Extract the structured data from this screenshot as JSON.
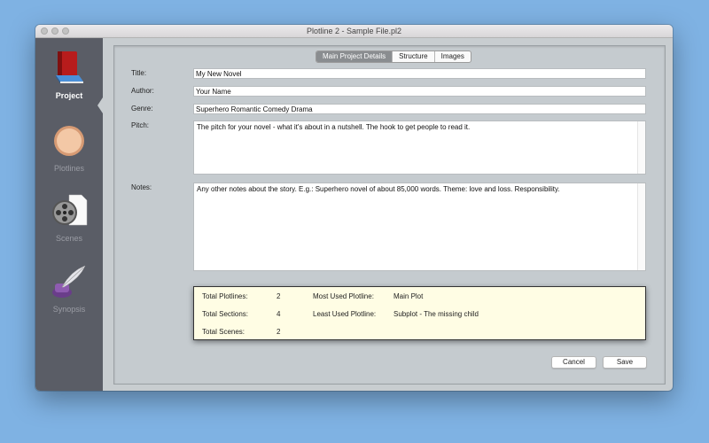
{
  "window": {
    "title": "Plotline 2 - Sample File.pl2"
  },
  "sidebar": {
    "items": [
      {
        "label": "Project",
        "icon": "book-icon"
      },
      {
        "label": "Plotlines",
        "icon": "plotline-circle-icon"
      },
      {
        "label": "Scenes",
        "icon": "film-reel-icon"
      },
      {
        "label": "Synopsis",
        "icon": "quill-inkwell-icon"
      }
    ]
  },
  "tabs": [
    "Main Project Details",
    "Structure",
    "Images"
  ],
  "form": {
    "title_label": "Title:",
    "title_value": "My New Novel",
    "author_label": "Author:",
    "author_value": "Your Name",
    "genre_label": "Genre:",
    "genre_value": "Superhero Romantic Comedy Drama",
    "pitch_label": "Pitch:",
    "pitch_value": "The pitch for your novel - what it's about in a nutshell. The hook to get people to read it.",
    "notes_label": "Notes:",
    "notes_value": "Any other notes about the story. E.g.: Superhero novel of about 85,000 words. Theme: love and loss. Responsibility."
  },
  "stats": {
    "total_plotlines_label": "Total Plotlines:",
    "total_plotlines": "2",
    "total_sections_label": "Total Sections:",
    "total_sections": "4",
    "total_scenes_label": "Total Scenes:",
    "total_scenes": "2",
    "most_used_label": "Most Used Plotline:",
    "most_used": "Main Plot",
    "least_used_label": "Least Used Plotline:",
    "least_used": "Subplot - The missing child"
  },
  "buttons": {
    "cancel": "Cancel",
    "save": "Save"
  },
  "colors": {
    "background": "#7fb2e3",
    "sidebar": "#5a5d66",
    "stats_bg": "#fffde4",
    "active_tab": "#8a8d90"
  }
}
